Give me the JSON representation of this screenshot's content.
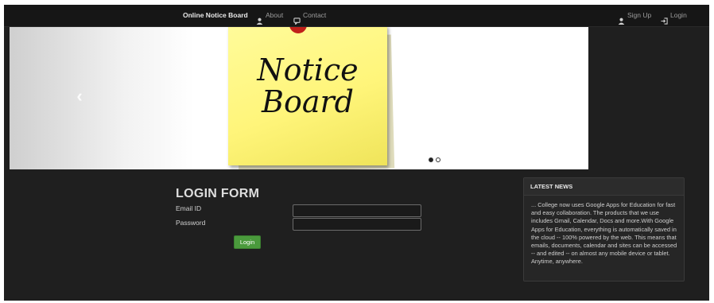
{
  "navbar": {
    "brand": "Online Notice Board",
    "about": "About",
    "contact": "Contact",
    "signup": "Sign Up",
    "login": "Login"
  },
  "carousel": {
    "prev_arrow": "‹",
    "slide_text_line1": "Notice",
    "slide_text_line2": "Board",
    "slide_count": 2,
    "active_slide": 1
  },
  "login_form": {
    "title": "LOGIN FORM",
    "email_label": "Email ID",
    "email_value": "",
    "password_label": "Password",
    "password_value": "",
    "submit_label": "Login"
  },
  "news": {
    "title": "LATEST NEWS",
    "body": "... College now uses Google Apps for Education for fast and easy collaboration. The products that we use includes Gmail, Calendar, Docs and more.With Google Apps for Education, everything is automatically saved in the cloud -- 100% powered by the web. This means that emails, documents, calendar and sites can be accessed -- and edited -- on almost any mobile device or tablet. Anytime, anywhere."
  },
  "icons": {
    "about": "user-icon",
    "contact": "comment-icon",
    "signup": "user-icon",
    "login": "login-arrow-icon",
    "prev": "chevron-left-icon"
  },
  "colors": {
    "page_bg": "#1f1f1f",
    "navbar_bg": "#161616",
    "button_green": "#4a9a3c",
    "note_yellow": "#fff57a"
  }
}
